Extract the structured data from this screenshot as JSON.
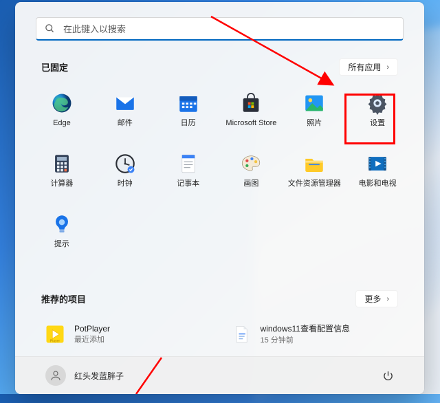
{
  "search": {
    "placeholder": "在此键入以搜索"
  },
  "pinned": {
    "title": "已固定",
    "all_apps_label": "所有应用",
    "apps": [
      {
        "label": "Edge",
        "icon": "edge"
      },
      {
        "label": "邮件",
        "icon": "mail"
      },
      {
        "label": "日历",
        "icon": "calendar"
      },
      {
        "label": "Microsoft Store",
        "icon": "store"
      },
      {
        "label": "照片",
        "icon": "photos"
      },
      {
        "label": "设置",
        "icon": "settings"
      },
      {
        "label": "计算器",
        "icon": "calculator"
      },
      {
        "label": "时钟",
        "icon": "clock"
      },
      {
        "label": "记事本",
        "icon": "notepad"
      },
      {
        "label": "画图",
        "icon": "paint"
      },
      {
        "label": "文件资源管理器",
        "icon": "explorer"
      },
      {
        "label": "电影和电视",
        "icon": "movies"
      },
      {
        "label": "提示",
        "icon": "tips"
      }
    ]
  },
  "recommended": {
    "title": "推荐的项目",
    "more_label": "更多",
    "items": [
      {
        "title": "PotPlayer",
        "subtitle": "最近添加",
        "icon": "potplayer"
      },
      {
        "title": "windows11查看配置信息",
        "subtitle": "15 分钟前",
        "icon": "document"
      }
    ]
  },
  "footer": {
    "user_name": "红头发蓝胖子"
  },
  "annotations": {
    "highlight_target": "settings",
    "arrow1_from": [
      307,
      24
    ],
    "arrow1_to": [
      478,
      122
    ],
    "arrow2_visible": true
  }
}
